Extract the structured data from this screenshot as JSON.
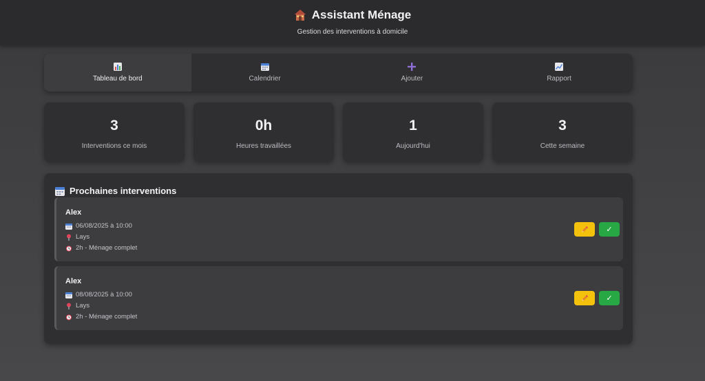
{
  "header": {
    "title": "Assistant Ménage",
    "subtitle": "Gestion des interventions à domicile",
    "title_icon": "house-icon"
  },
  "nav": {
    "tabs": [
      {
        "label": "Tableau de bord",
        "icon": "bar-chart-icon",
        "active": true
      },
      {
        "label": "Calendrier",
        "icon": "calendar-icon",
        "active": false
      },
      {
        "label": "Ajouter",
        "icon": "plus-icon",
        "active": false
      },
      {
        "label": "Rapport",
        "icon": "line-chart-icon",
        "active": false
      }
    ]
  },
  "stats": [
    {
      "value": "3",
      "label": "Interventions ce mois"
    },
    {
      "value": "0h",
      "label": "Heures travaillées"
    },
    {
      "value": "1",
      "label": "Aujourd'hui"
    },
    {
      "value": "3",
      "label": "Cette semaine"
    }
  ],
  "upcoming": {
    "title": "Prochaines interventions",
    "title_icon": "calendar-icon",
    "items": [
      {
        "client": "Alex",
        "datetime": "06/08/2025 à 10:00",
        "location": "Lays",
        "duration": "2h - Ménage complet",
        "edit_icon": "pencil-icon",
        "done_label": "✓"
      },
      {
        "client": "Alex",
        "datetime": "08/08/2025 à 10:00",
        "location": "Lays",
        "duration": "2h - Ménage complet",
        "edit_icon": "pencil-icon",
        "done_label": "✓"
      }
    ]
  },
  "colors": {
    "accent_edit": "#f4c20d",
    "accent_done": "#27a844",
    "plus_icon": "#8e6fd6"
  }
}
